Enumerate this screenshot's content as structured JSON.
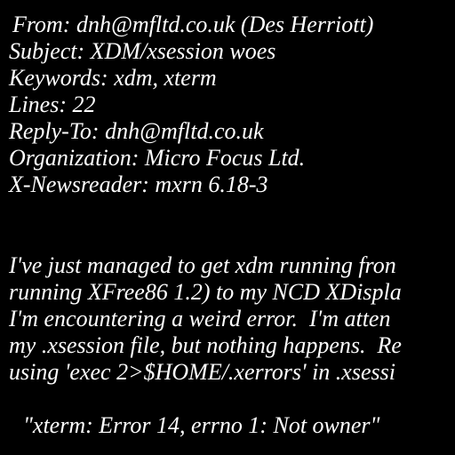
{
  "colors": {
    "background": "#000000",
    "text": "#ffffff"
  },
  "headers": {
    "from": "From: dnh@mfltd.co.uk (Des Herriott)",
    "subject": "Subject: XDM/xsession woes",
    "keywords": "Keywords: xdm, xterm",
    "lines": "Lines: 22",
    "reply_to": "Reply-To: dnh@mfltd.co.uk",
    "organization": "Organization: Micro Focus Ltd.",
    "newsreader": "X-Newsreader: mxrn 6.18-3"
  },
  "body": {
    "lines": [
      "I've just managed to get xdm running fron",
      "running XFree86 1.2) to my NCD XDispla",
      "I'm encountering a weird error.  I'm atten",
      "my .xsession file, but nothing happens.  Re",
      "using 'exec 2>$HOME/.xerrors' in .xsessi"
    ],
    "quote": "\"xterm: Error 14, errno 1: Not owner\""
  }
}
